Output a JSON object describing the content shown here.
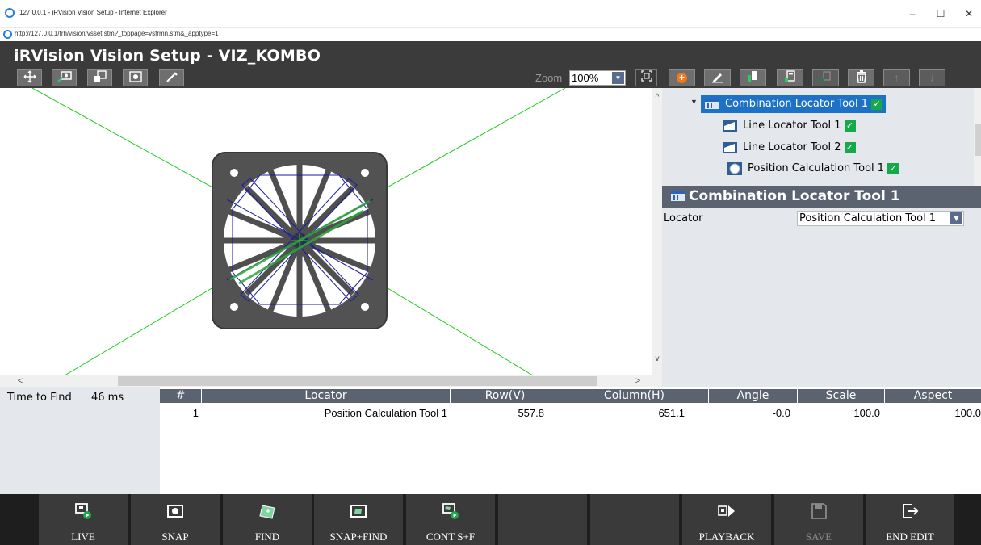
{
  "window": {
    "title": "127.0.0.1 - iRVision Vision Setup - Internet Explorer",
    "url": "http://127.0.0.1/frh/vision/vsset.stm?_toppage=vsfrmn.stm&_apptype=1",
    "controls": {
      "minimize": "–",
      "maximize": "☐",
      "close": "✕"
    }
  },
  "app": {
    "title": "iRVision Vision Setup - VIZ_KOMBO"
  },
  "image_toolbar": {
    "zoom_label": "Zoom",
    "zoom_value": "100%",
    "dropdown_arrow": "▼",
    "buttons": [
      "move-icon",
      "camera-train-icon",
      "save-image-icon",
      "camera-setup-icon",
      "eyedropper-icon",
      "fit-icon"
    ]
  },
  "tree_toolbar": {
    "buttons": [
      "add-icon",
      "edit-icon",
      "insert-icon",
      "copy-icon",
      "paste-icon",
      "delete-icon",
      "up-icon",
      "down-icon"
    ]
  },
  "tree": {
    "items": [
      {
        "label": "Combination Locator Tool 1",
        "level": 0,
        "selected": true,
        "checked": true
      },
      {
        "label": "Line Locator Tool 1",
        "level": 1,
        "selected": false,
        "checked": true
      },
      {
        "label": "Line Locator Tool 2",
        "level": 1,
        "selected": false,
        "checked": true
      },
      {
        "label": "Position Calculation Tool 1",
        "level": 1,
        "selected": false,
        "checked": true
      }
    ]
  },
  "properties": {
    "title": "Combination Locator Tool 1",
    "locator_label": "Locator",
    "locator_value": "Position Calculation Tool 1"
  },
  "results": {
    "time_label": "Time to Find",
    "time_value": "46 ms",
    "columns": [
      "#",
      "Locator",
      "Row(V)",
      "Column(H)",
      "Angle",
      "Scale",
      "Aspect"
    ],
    "rows": [
      {
        "num": "1",
        "locator": "Position Calculation Tool 1",
        "row": "557.8",
        "column": "651.1",
        "angle": "-0.0",
        "scale": "100.0",
        "aspect": "100.0"
      }
    ]
  },
  "scrollbars": {
    "up": "^",
    "down": "v",
    "left": "<",
    "right": ">"
  },
  "function_keys": [
    {
      "label": "LIVE",
      "icon": "live-camera-icon",
      "enabled": true
    },
    {
      "label": "SNAP",
      "icon": "snap-camera-icon",
      "enabled": true
    },
    {
      "label": "FIND",
      "icon": "find-icon",
      "enabled": true
    },
    {
      "label": "SNAP+FIND",
      "icon": "snap-find-icon",
      "enabled": true
    },
    {
      "label": "CONT S+F",
      "icon": "continuous-snap-find-icon",
      "enabled": true
    },
    {
      "label": "",
      "icon": "",
      "enabled": false
    },
    {
      "label": "",
      "icon": "",
      "enabled": false
    },
    {
      "label": "PLAYBACK",
      "icon": "playback-icon",
      "enabled": true
    },
    {
      "label": "SAVE",
      "icon": "save-icon",
      "enabled": false
    },
    {
      "label": "END EDIT",
      "icon": "exit-icon",
      "enabled": true
    }
  ],
  "colors": {
    "header_bg": "#3b3b3b",
    "selection": "#1e72c6",
    "check_green": "#17a84a",
    "grid_header": "#5b6371",
    "panel_bg": "#e4e8ec",
    "overlay_green": "#22cc22",
    "overlay_blue": "#1a1aa8"
  }
}
